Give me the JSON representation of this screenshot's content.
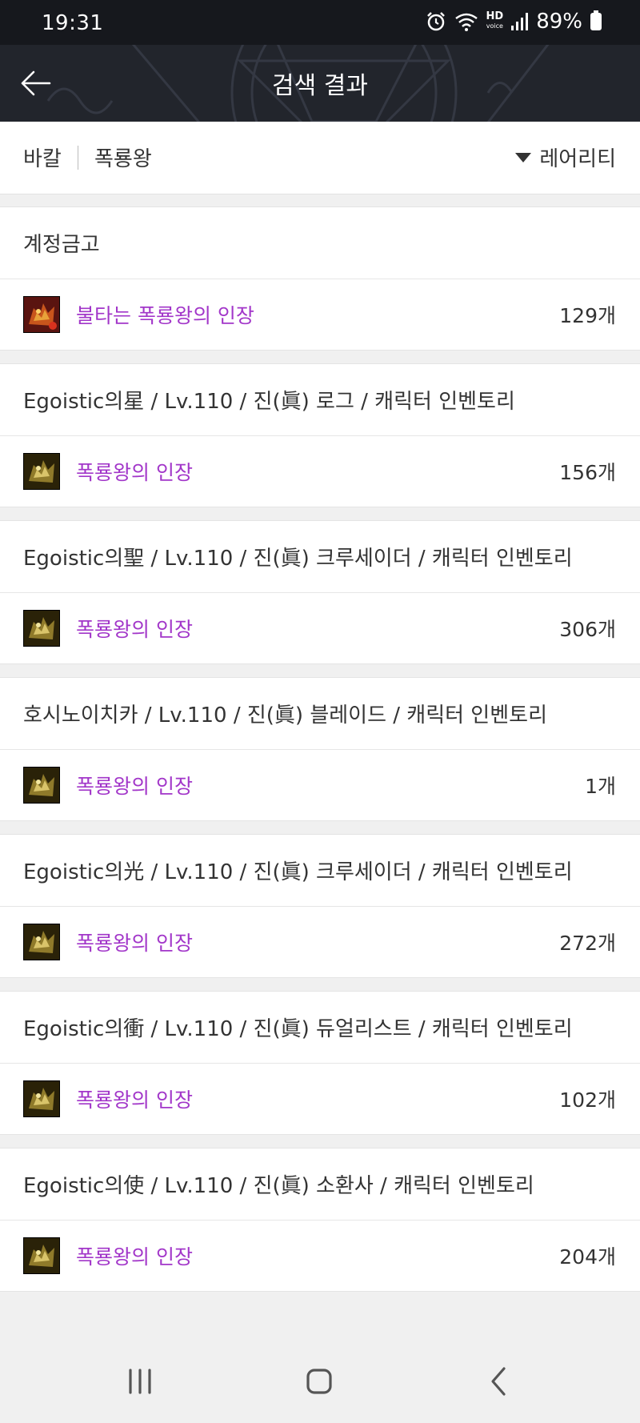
{
  "status_bar": {
    "time": "19:31",
    "hd_label": "HD",
    "voice_label": "voice",
    "battery": "89%"
  },
  "header": {
    "title": "검색 결과",
    "back_icon": "arrow-left-icon"
  },
  "filter": {
    "server": "바칼",
    "query": "폭룡왕",
    "sort_label": "레어리티"
  },
  "groups": [
    {
      "title": "계정금고",
      "item": {
        "name": "불타는 폭룡왕의 인장",
        "count": "129개",
        "icon": "burning-seal-icon"
      }
    },
    {
      "title": "Egoistic의星 / Lv.110 / 진(眞) 로그 / 캐릭터 인벤토리",
      "item": {
        "name": "폭룡왕의 인장",
        "count": "156개",
        "icon": "seal-icon"
      }
    },
    {
      "title": "Egoistic의聖 / Lv.110 / 진(眞) 크루세이더 / 캐릭터 인벤토리",
      "item": {
        "name": "폭룡왕의 인장",
        "count": "306개",
        "icon": "seal-icon"
      }
    },
    {
      "title": "호시노이치카 / Lv.110 / 진(眞) 블레이드 / 캐릭터 인벤토리",
      "item": {
        "name": "폭룡왕의 인장",
        "count": "1개",
        "icon": "seal-icon"
      }
    },
    {
      "title": "Egoistic의光 / Lv.110 / 진(眞) 크루세이더 / 캐릭터 인벤토리",
      "item": {
        "name": "폭룡왕의 인장",
        "count": "272개",
        "icon": "seal-icon"
      }
    },
    {
      "title": "Egoistic의衝 / Lv.110 / 진(眞) 듀얼리스트 / 캐릭터 인벤토리",
      "item": {
        "name": "폭룡왕의 인장",
        "count": "102개",
        "icon": "seal-icon"
      }
    },
    {
      "title": "Egoistic의使 / Lv.110 / 진(眞) 소환사 / 캐릭터 인벤토리",
      "item": {
        "name": "폭룡왕의 인장",
        "count": "204개",
        "icon": "seal-icon"
      }
    }
  ],
  "nav": {
    "recent": "recent-apps-icon",
    "home": "home-icon",
    "back": "back-chevron-icon"
  },
  "colors": {
    "item_name": "#a236c9",
    "header_bg": "#22252c",
    "status_bg": "#16181d"
  }
}
